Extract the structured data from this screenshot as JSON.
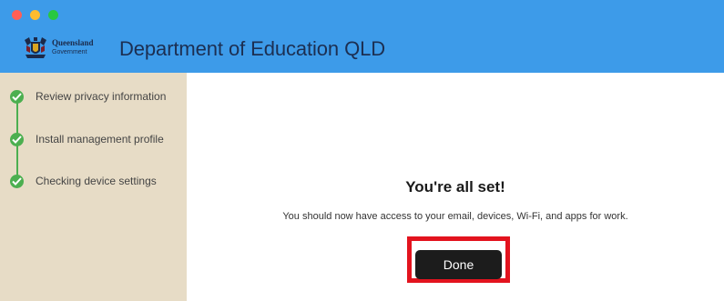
{
  "window": {
    "controls": {
      "close_color": "#ff5f57",
      "minimize_color": "#febc2e",
      "maximize_color": "#28c840"
    }
  },
  "header": {
    "background": "#3d9be9",
    "logo": {
      "icon": "queensland-crest-icon",
      "line1": "Queensland",
      "line2": "Government"
    },
    "title": "Department of Education QLD"
  },
  "sidebar": {
    "background": "#e7dcc6",
    "accent": "#4caf50",
    "steps": [
      {
        "label": "Review privacy information",
        "status": "complete",
        "icon": "check-circle-icon"
      },
      {
        "label": "Install management profile",
        "status": "complete",
        "icon": "check-circle-icon"
      },
      {
        "label": "Checking device settings",
        "status": "complete",
        "icon": "check-circle-icon"
      }
    ]
  },
  "main": {
    "title": "You're all set!",
    "message": "You should now have access to your email, devices, Wi-Fi, and apps for work.",
    "done_label": "Done",
    "highlight_color": "#e3131e"
  }
}
